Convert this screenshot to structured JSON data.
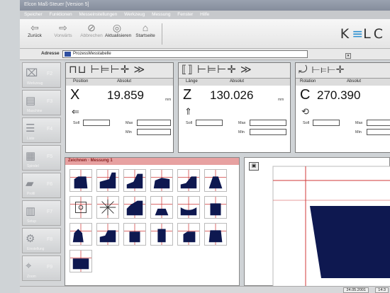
{
  "window": {
    "title": "Elcon Maß-Steuer [Version 5]"
  },
  "menu": [
    "Speicher",
    "Funktionen",
    "Messeinstellungen",
    "Werkzeug",
    "Messung",
    "Fenster",
    "Hilfe"
  ],
  "toolbar": {
    "back_label": "Zurück",
    "forward_label": "Vorwärts",
    "stop_label": "Abbrechen",
    "refresh_label": "Aktualisieren",
    "home_label": "Startseite",
    "logo_pre": "K",
    "logo_bars": "≡",
    "logo_post": "LC"
  },
  "address": {
    "label": "Adresse",
    "value": "ProzessMesstabelle"
  },
  "sidebar": [
    {
      "icon": "tool-icon",
      "glyph": "⌧",
      "num": "F2",
      "sub": "Werkzeug"
    },
    {
      "icon": "machine-icon",
      "glyph": "▤",
      "num": "F3",
      "sub": "Maschine"
    },
    {
      "icon": "list-icon",
      "glyph": "☰",
      "num": "F4",
      "sub": "Liste"
    },
    {
      "icon": "spindle-icon",
      "glyph": "▦",
      "num": "F5",
      "sub": "Spindel"
    },
    {
      "icon": "profile-icon",
      "glyph": "▰",
      "num": "F6",
      "sub": "Profil"
    },
    {
      "icon": "setup-icon",
      "glyph": "▥",
      "num": "F7",
      "sub": "Setup"
    },
    {
      "icon": "settings-icon",
      "glyph": "⚙",
      "num": "F8",
      "sub": "Einstellung"
    },
    {
      "icon": "zoom-icon",
      "glyph": "⌖",
      "num": "F9",
      "sub": "Zoom"
    }
  ],
  "axes": [
    {
      "tools": "⊓⊔ ⊢⊨⊢✛ ≫",
      "h1": "Position",
      "h2": "Absolut",
      "letter": "X",
      "value": "19.859",
      "unit": "mm",
      "mode_icon": "⇐",
      "soll": "Soll",
      "min": "Min",
      "max": "Max"
    },
    {
      "tools": "⟦⟧ ⊢⊨⊢✛ ≫",
      "h1": "Länge",
      "h2": "Absolut",
      "letter": "Z",
      "value": "130.026",
      "unit": "mm",
      "mode_icon": "⇑",
      "soll": "Soll",
      "min": "Min",
      "max": "Max"
    },
    {
      "tools": "⤾ ⊢⊨⊢✛",
      "h1": "Rotation",
      "h2": "Absolut",
      "letter": "C",
      "value": "270.390",
      "unit": "",
      "mode_icon": "⟲",
      "soll": "Soll",
      "min": "Min",
      "max": "Max"
    }
  ],
  "contour": {
    "title": "Zeichnen · Messung 1"
  },
  "status": {
    "date": "24.05.2001",
    "time": "14:3"
  },
  "colors": {
    "shape_fill": "#0e1850",
    "guide_red": "#d03a3a",
    "title_pink": "#e7a1a1"
  }
}
